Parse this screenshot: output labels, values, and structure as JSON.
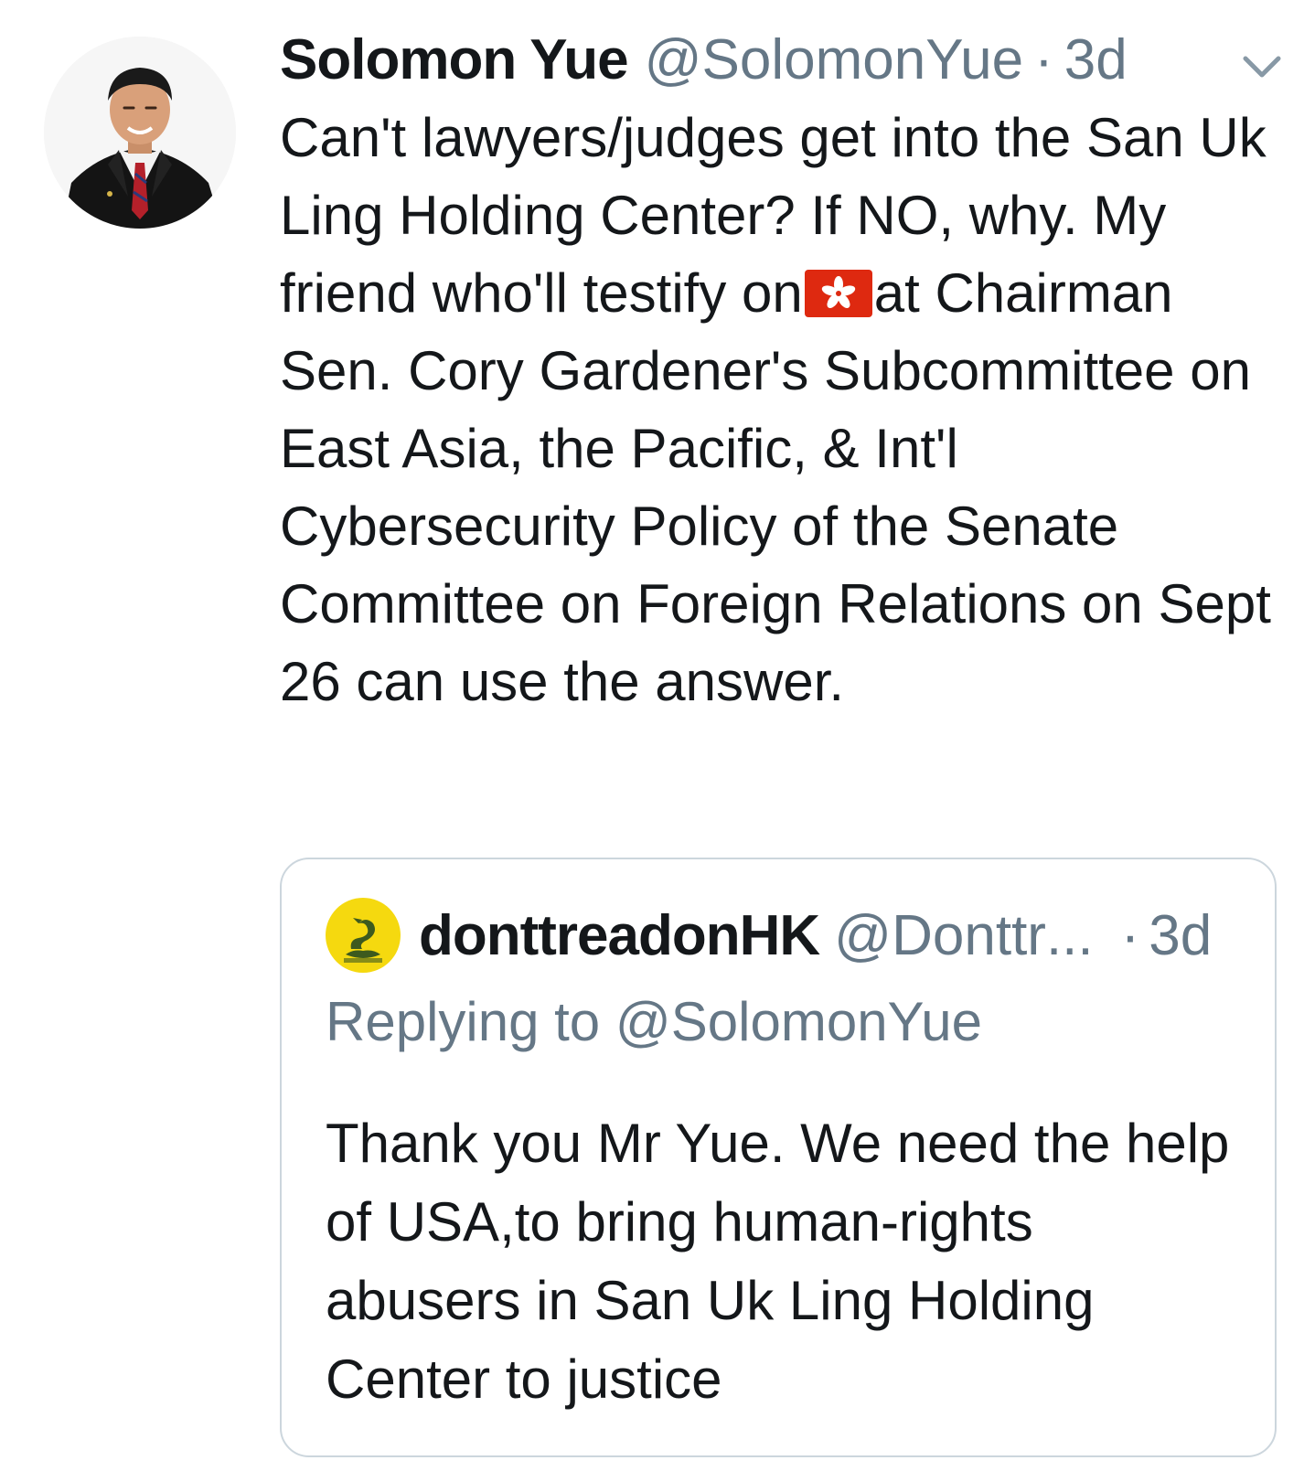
{
  "tweet": {
    "author_name": "Solomon Yue",
    "author_handle": "@SolomonYue",
    "separator": "·",
    "time": "3d",
    "text_before_flag": "Can't lawyers/judges get into the San Uk Ling Holding Center? If NO, why. My friend who'll testify on",
    "flag_emoji": "hong-kong-flag-icon",
    "text_after_flag": "at Chairman Sen. Cory Gardener's Subcommittee on East Asia, the Pacific, & Int'l Cybersecurity Policy of the Senate Committee on Foreign Relations on Sept 26 can use the answer."
  },
  "quoted_tweet": {
    "author_name": "donttreadonHK",
    "author_handle": "@Donttr",
    "ellipsis": "...",
    "separator": "·",
    "time": "3d",
    "replying_to": "Replying to @SolomonYue",
    "text": "Thank you Mr Yue. We need the help of USA,to bring human-rights abusers in San Uk Ling Holding Center to justice"
  },
  "colors": {
    "text_primary": "#14171a",
    "text_secondary": "#657786",
    "border": "#ccd6dd",
    "flag_red": "#de2910",
    "gadsden_yellow": "#f5d90f"
  }
}
